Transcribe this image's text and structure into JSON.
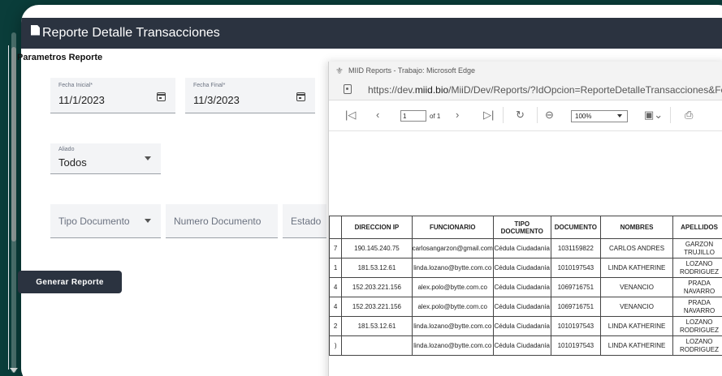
{
  "app": {
    "header_title": "Reporte Detalle Transacciones"
  },
  "form": {
    "section_title": "Parametros Reporte",
    "fecha_inicial": {
      "label": "Fecha Inicial*",
      "value": "11/1/2023"
    },
    "fecha_final": {
      "label": "Fecha Final*",
      "value": "11/3/2023"
    },
    "aliado": {
      "label": "Aliado",
      "value": "Todos"
    },
    "tipo_documento": {
      "placeholder": "Tipo Documento"
    },
    "numero_documento": {
      "placeholder": "Numero Documento"
    },
    "estado": {
      "placeholder": "Estado"
    },
    "generate_label": "Generar Reporte"
  },
  "edge": {
    "window_title": "MIID Reports - Trabajo: Microsoft Edge",
    "url_prefix": "https://dev.",
    "url_host": "miid.bio",
    "url_rest": "/MiiD/Dev/Reports/?IdOpcion=ReporteDetalleTransacciones&FechaIn",
    "toolbar": {
      "page_value": "1",
      "page_of": "of 1",
      "zoom": "100%"
    }
  },
  "table": {
    "headers": [
      "",
      "DIRECCION IP",
      "FUNCIONARIO",
      "TIPO DOCUMENTO",
      "DOCUMENTO",
      "NOMBRES",
      "APELLIDOS"
    ],
    "rows": [
      [
        "7",
        "190.145.240.75",
        "carlosangarzon@gmail.com",
        "Cédula Ciudadanía",
        "1031159822",
        "CARLOS ANDRES",
        "GARZON TRUJILLO"
      ],
      [
        "1",
        "181.53.12.61",
        "linda.lozano@bytte.com.co",
        "Cédula Ciudadanía",
        "1010197543",
        "LINDA KATHERINE",
        "LOZANO RODRIGUEZ"
      ],
      [
        "4",
        "152.203.221.156",
        "alex.polo@bytte.com.co",
        "Cédula Ciudadanía",
        "1069716751",
        "VENANCIO",
        "PRADA NAVARRO"
      ],
      [
        "4",
        "152.203.221.156",
        "alex.polo@bytte.com.co",
        "Cédula Ciudadanía",
        "1069716751",
        "VENANCIO",
        "PRADA NAVARRO"
      ],
      [
        "2",
        "181.53.12.61",
        "linda.lozano@bytte.com.co",
        "Cédula Ciudadanía",
        "1010197543",
        "LINDA KATHERINE",
        "LOZANO RODRIGUEZ"
      ],
      [
        ")",
        "",
        "linda.lozano@bytte.com.co",
        "Cédula Ciudadanía",
        "1010197543",
        "LINDA KATHERINE",
        "LOZANO RODRIGUEZ"
      ]
    ]
  },
  "colors": {
    "header_bg": "#2b3340",
    "page_bg": "#0a3d3a",
    "field_bg": "#f3f4f6"
  }
}
